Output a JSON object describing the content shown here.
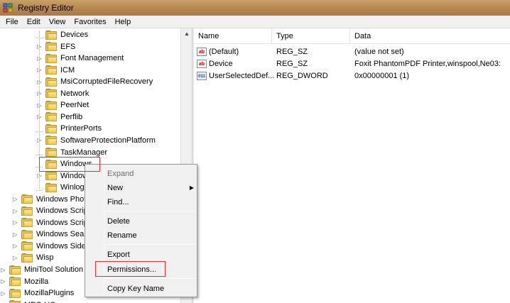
{
  "window": {
    "title": "Registry Editor"
  },
  "menubar": [
    "File",
    "Edit",
    "View",
    "Favorites",
    "Help"
  ],
  "tree": {
    "items": [
      {
        "label": "Devices",
        "expandable": false
      },
      {
        "label": "EFS",
        "expandable": true
      },
      {
        "label": "Font Management",
        "expandable": true
      },
      {
        "label": "ICM",
        "expandable": true
      },
      {
        "label": "MsiCorruptedFileRecovery",
        "expandable": true
      },
      {
        "label": "Network",
        "expandable": true
      },
      {
        "label": "PeerNet",
        "expandable": true
      },
      {
        "label": "Perflib",
        "expandable": true
      },
      {
        "label": "PrinterPorts",
        "expandable": false
      },
      {
        "label": "SoftwareProtectionPlatform",
        "expandable": true
      },
      {
        "label": "TaskManager",
        "expandable": false
      },
      {
        "label": "Windows",
        "expandable": false,
        "selected": true
      },
      {
        "label": "Window",
        "expandable": true
      },
      {
        "label": "Winlog",
        "expandable": false
      },
      {
        "label": "Windows Phot",
        "expandable": true
      },
      {
        "label": "Windows Scrip",
        "expandable": true
      },
      {
        "label": "Windows Scrip",
        "expandable": true
      },
      {
        "label": "Windows Searc",
        "expandable": true
      },
      {
        "label": "Windows Sideb",
        "expandable": true
      },
      {
        "label": "Wisp",
        "expandable": true
      },
      {
        "label": "MiniTool Solution",
        "expandable": true
      },
      {
        "label": "Mozilla",
        "expandable": true
      },
      {
        "label": "MozillaPlugins",
        "expandable": true
      },
      {
        "label": "MPC-HC",
        "expandable": true
      }
    ]
  },
  "list": {
    "columns": {
      "name": "Name",
      "type": "Type",
      "data": "Data"
    },
    "rows": [
      {
        "icon": "ab",
        "name": "(Default)",
        "type": "REG_SZ",
        "data": "(value not set)"
      },
      {
        "icon": "ab",
        "name": "Device",
        "type": "REG_SZ",
        "data": "Foxit PhantomPDF Printer,winspool,Ne03:"
      },
      {
        "icon": "011",
        "name": "UserSelectedDef...",
        "type": "REG_DWORD",
        "data": "0x00000001 (1)"
      }
    ]
  },
  "context_menu": {
    "expand": "Expand",
    "new": "New",
    "find": "Find...",
    "delete": "Delete",
    "rename": "Rename",
    "export": "Export",
    "permissions": "Permissions...",
    "copy_key_name": "Copy Key Name"
  },
  "icons": {
    "app": "registry-editor-icon",
    "folder": "folder-icon",
    "string_value": "reg-sz-icon",
    "dword_value": "reg-dword-icon",
    "submenu": "chevron-right-icon"
  },
  "colors": {
    "highlight_box": "#e03030"
  }
}
